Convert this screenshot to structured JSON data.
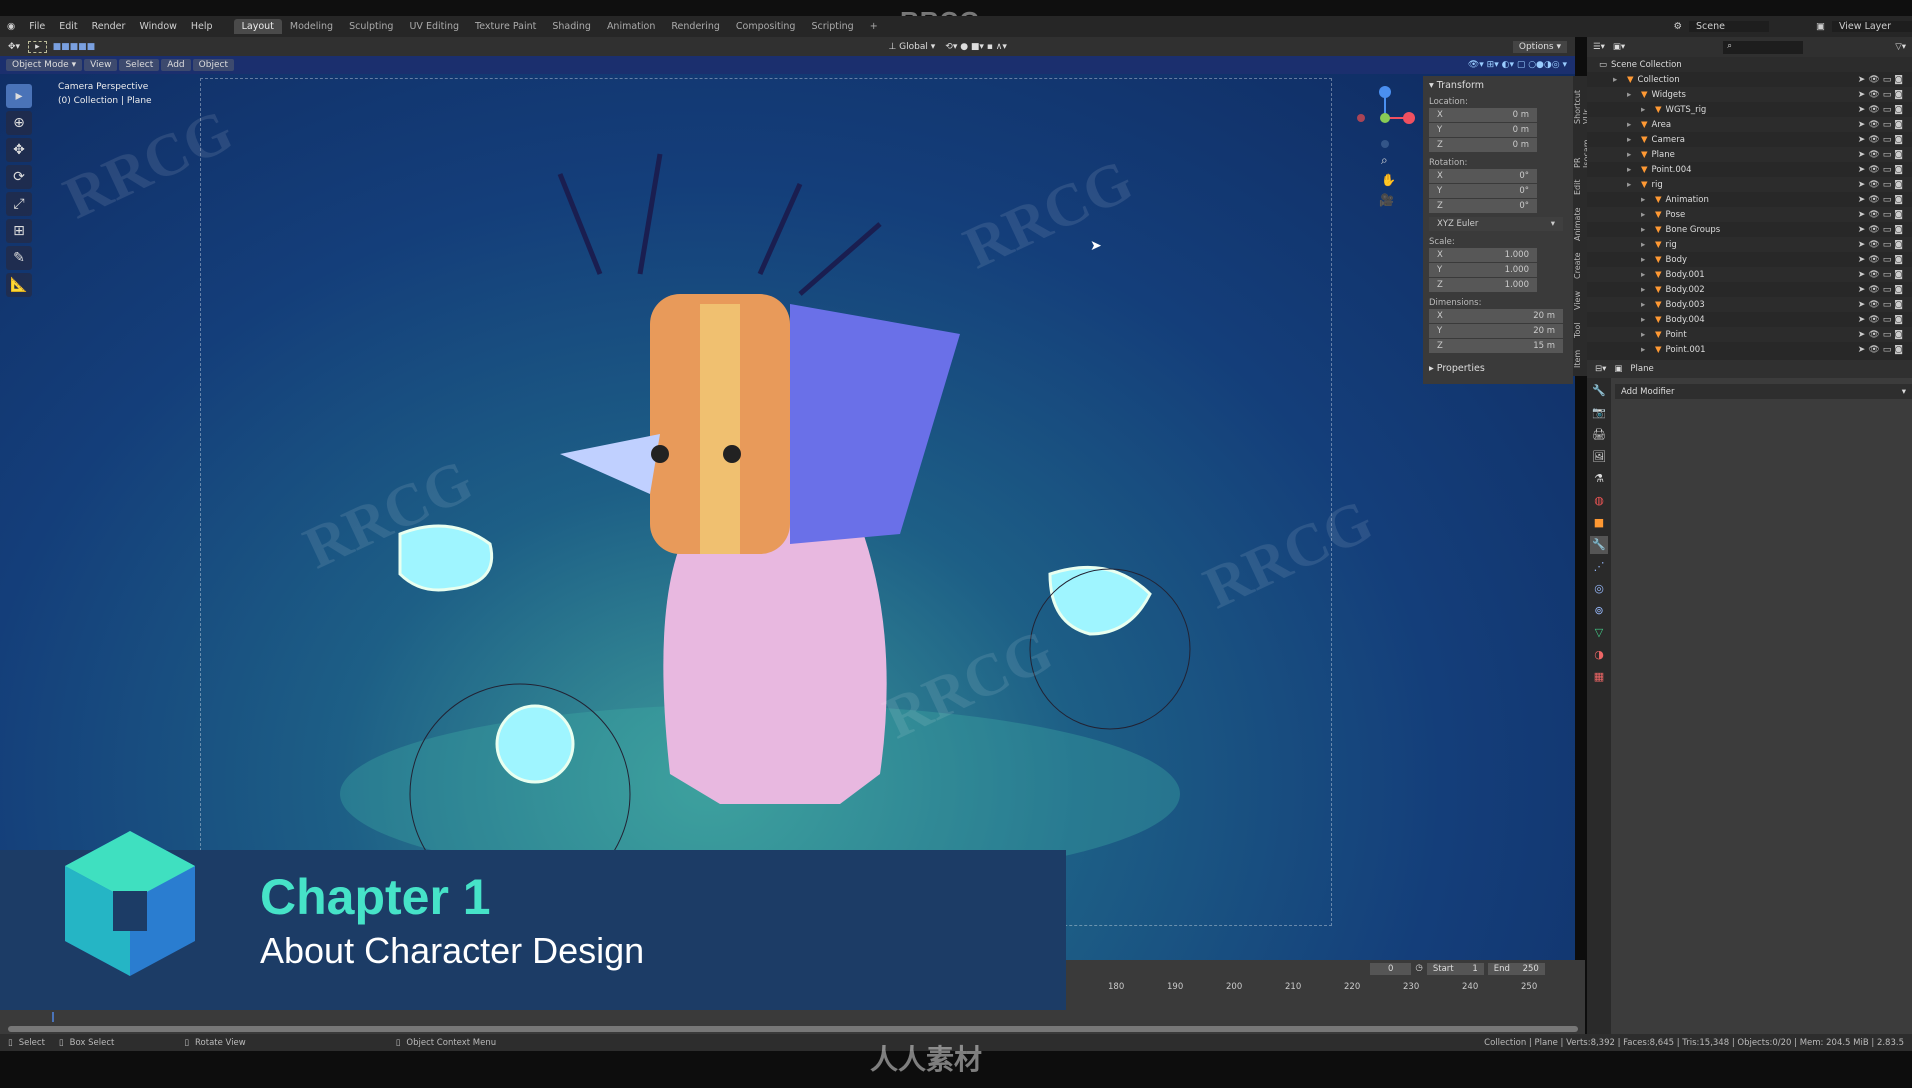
{
  "watermark_title": "RRCG",
  "menu": {
    "items": [
      "File",
      "Edit",
      "Render",
      "Window",
      "Help"
    ],
    "workspaces": [
      "Layout",
      "Modeling",
      "Sculpting",
      "UV Editing",
      "Texture Paint",
      "Shading",
      "Animation",
      "Rendering",
      "Compositing",
      "Scripting",
      "+"
    ],
    "active_workspace": "Layout",
    "scene": "Scene",
    "view_layer": "View Layer"
  },
  "toolheader": {
    "orientation": "Global",
    "options": "Options"
  },
  "viewport_header": {
    "mode": "Object Mode",
    "menus": [
      "View",
      "Select",
      "Add",
      "Object"
    ]
  },
  "viewport": {
    "camera": "Camera Perspective",
    "collection": "(0) Collection | Plane"
  },
  "npanel": {
    "title": "Transform",
    "location_label": "Location:",
    "location": [
      "0 m",
      "0 m",
      "0 m"
    ],
    "rotation_label": "Rotation:",
    "rotation": [
      "0°",
      "0°",
      "0°"
    ],
    "rotation_mode": "XYZ Euler",
    "scale_label": "Scale:",
    "scale": [
      "1.000",
      "1.000",
      "1.000"
    ],
    "dimensions_label": "Dimensions:",
    "dimensions": [
      "20 m",
      "20 m",
      "15 m"
    ],
    "properties": "Properties",
    "axes": [
      "X",
      "Y",
      "Z"
    ],
    "tabs": [
      "Item",
      "Tool",
      "View",
      "Create",
      "Animate",
      "Edit",
      "PR Isocam",
      "Shortcut VUr"
    ]
  },
  "outliner": {
    "root": "Scene Collection",
    "rows": [
      {
        "name": "Collection",
        "indent": 1
      },
      {
        "name": "Widgets",
        "indent": 2
      },
      {
        "name": "WGTS_rig",
        "indent": 3
      },
      {
        "name": "Area",
        "indent": 2
      },
      {
        "name": "Camera",
        "indent": 2
      },
      {
        "name": "Plane",
        "indent": 2
      },
      {
        "name": "Point.004",
        "indent": 2
      },
      {
        "name": "rig",
        "indent": 2
      },
      {
        "name": "Animation",
        "indent": 3
      },
      {
        "name": "Pose",
        "indent": 3
      },
      {
        "name": "Bone Groups",
        "indent": 3
      },
      {
        "name": "rig",
        "indent": 3
      },
      {
        "name": "Body",
        "indent": 3
      },
      {
        "name": "Body.001",
        "indent": 3
      },
      {
        "name": "Body.002",
        "indent": 3
      },
      {
        "name": "Body.003",
        "indent": 3
      },
      {
        "name": "Body.004",
        "indent": 3
      },
      {
        "name": "Point",
        "indent": 3
      },
      {
        "name": "Point.001",
        "indent": 3
      }
    ]
  },
  "properties": {
    "object": "Plane",
    "add_modifier": "Add Modifier"
  },
  "timeline": {
    "current_frame": "0",
    "start_label": "Start",
    "start": "1",
    "end_label": "End",
    "end": "250",
    "ticks": [
      "180",
      "190",
      "200",
      "210",
      "220",
      "230",
      "240",
      "250"
    ]
  },
  "chapter": {
    "title": "Chapter 1",
    "subtitle": "About Character Design"
  },
  "statusbar": {
    "select": "Select",
    "box_select": "Box Select",
    "rotate": "Rotate View",
    "context": "Object Context Menu",
    "stats": "Collection | Plane | Verts:8,392 | Faces:8,645 | Tris:15,348 | Objects:0/20 | Mem: 204.5 MiB | 2.83.5"
  },
  "bottom_watermark": "人人素材",
  "colors": {
    "accent": "#4a73b8",
    "chapter_teal": "#46e3c8",
    "chapter_bg": "#1c3c66"
  }
}
